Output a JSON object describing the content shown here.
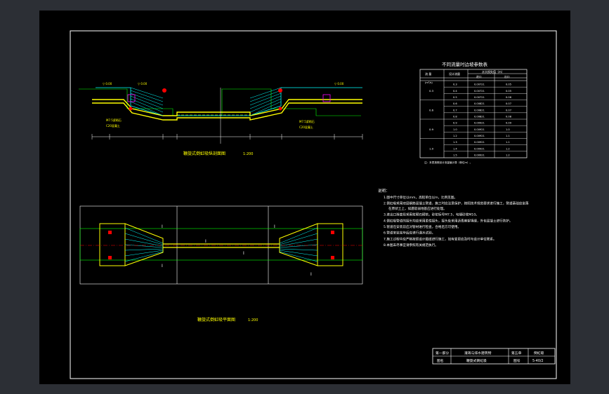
{
  "drawing": {
    "section_title": "鞭旋式倒虹吸纵剖面图",
    "section_scale": "1:200",
    "plan_title": "鞭旋式倒虹吸平面图",
    "plan_scale": "1:200",
    "plan_marks": {
      "cut_a": "I",
      "cut_b": "I",
      "cut_c": "I",
      "cut_d": "I",
      "cut_e": "I",
      "cut_f": "I"
    }
  },
  "param_table": {
    "title": "不同流量时边坡参数表",
    "headers": [
      "流  量",
      "设计流量",
      "水头损失值（m）",
      "进口",
      "出口"
    ],
    "row_unit": "(m³/s)",
    "groups": [
      {
        "flow": "0.3",
        "rows": [
          {
            "q": "0.3",
            "a": "0.00721",
            "b": "0.05"
          },
          {
            "q": "0.4",
            "a": "0.00721",
            "b": "0.05"
          },
          {
            "q": "0.5",
            "a": "0.00721",
            "b": "0.06"
          }
        ]
      },
      {
        "flow": "0.6",
        "rows": [
          {
            "q": "0.6",
            "a": "0.00821",
            "b": "0.07"
          },
          {
            "q": "0.7",
            "a": "0.00821",
            "b": "0.07"
          },
          {
            "q": "0.8",
            "a": "0.00821",
            "b": "0.08"
          }
        ]
      },
      {
        "flow": "0.9",
        "rows": [
          {
            "q": "0.9",
            "a": "0.00921",
            "b": "0.09"
          },
          {
            "q": "1.0",
            "a": "0.00921",
            "b": "1.0"
          },
          {
            "q": "1.2",
            "a": "0.00921",
            "b": "1.1"
          }
        ]
      },
      {
        "flow": "1.0",
        "rows": [
          {
            "q": "1.3",
            "a": "0.00921",
            "b": "1.1"
          },
          {
            "q": "1.4",
            "a": "0.00921",
            "b": "1.2"
          },
          {
            "q": "1.5",
            "a": "0.00921",
            "b": "1.2"
          }
        ]
      }
    ],
    "note": "注：本表按照设计流量值计算（单位m）。"
  },
  "notes": {
    "heading": "说明：",
    "items": [
      "1.图中尺寸单位以mm，高程单位以m，比例见图。",
      "2.倒虹吸采用双层钢筋混凝土管道，施工时应注意保护，按照技术规范要求进行施工，管道基础应坐落在原状土上，如遇软弱地基应进行处理。",
      "3.进出口渐变段采用浆砌石砌筑，砂浆标号M7.5，勾缝砂浆M10。",
      "4.倒虹吸管道的接头均应采用柔性接头，接头处采用沥青麻絮填缝，外包混凝土进行防护。",
      "5.管道在安装前应对管材进行检查，合格后方可使用。",
      "6.管道安装完毕后应进行通水试验。",
      "7.施工过程中应严格按照设计图纸进行施工，如有变更应及时与设计单位联系。",
      "8.本图未尽事宜请参照有关规范执行。"
    ]
  },
  "title_block": {
    "part_label": "第一部分",
    "project": "灌溉与排水建筑物",
    "chapter": "第五章",
    "category": "倒虹吸",
    "drawing_name_label": "图名",
    "drawing_name": "鞭旋式倒虹吸",
    "drawing_no_label": "图号",
    "drawing_no": "5-40/2"
  }
}
